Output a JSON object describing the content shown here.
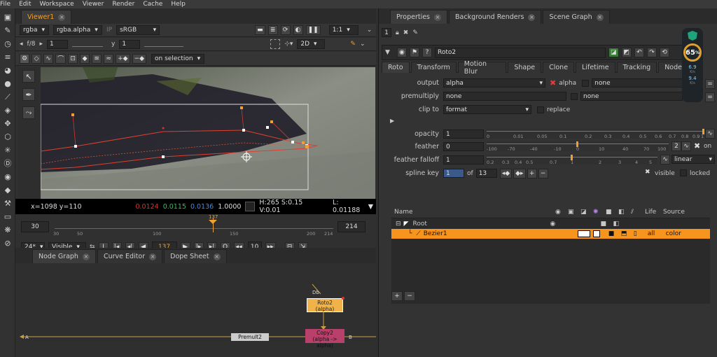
{
  "menu": [
    "File",
    "Edit",
    "Workspace",
    "Viewer",
    "Render",
    "Cache",
    "Help"
  ],
  "viewer": {
    "tab": "Viewer1",
    "channels": "rgba",
    "channel_alpha": "rgba.alpha",
    "ip": "IP",
    "colorspace": "sRGB",
    "zoom": "1:1",
    "fstop": "f/8",
    "frame_inc": "1",
    "y_label": "y",
    "y_value": "1",
    "mode2d": "2D",
    "onselection": "on selection",
    "info": {
      "coords": "x=1098 y=110",
      "r": "0.0124",
      "g": "0.0115",
      "b": "0.0136",
      "a": "1.0000",
      "hsv": "H:265 S:0.15 V:0.01",
      "lum": "L: 0.01188"
    },
    "timeline": {
      "start": "30",
      "end": "214",
      "current": "137",
      "ticks": [
        "30",
        "50",
        "100",
        "150",
        "200",
        "214"
      ],
      "fps": "24*",
      "visible": "Visible",
      "frame": "137",
      "step": "10"
    }
  },
  "nodegraph": {
    "tabs": [
      "Node Graph",
      "Curve Editor",
      "Dope Sheet"
    ],
    "nodes": {
      "roto": "Roto2",
      "roto_sub": "(alpha)",
      "copy": "Copy2",
      "copy_sub": "(alpha -> alpha)",
      "premult": "Premult2"
    },
    "pin_a": "A",
    "pin_b": "B",
    "pin_db": "Db"
  },
  "properties": {
    "tabs": [
      "Properties",
      "Background Renders",
      "Scene Graph"
    ],
    "count": "1",
    "node_name": "Roto2",
    "subtabs": [
      "Roto",
      "Transform",
      "Motion Blur",
      "Shape",
      "Clone",
      "Lifetime",
      "Tracking",
      "Node"
    ],
    "output_label": "output",
    "output_value": "alpha",
    "alpha_label": "alpha",
    "output_none": "none",
    "premultiply_label": "premultiply",
    "premultiply_value": "none",
    "premultiply_none": "none",
    "clipto_label": "clip to",
    "clipto_value": "format",
    "replace_label": "replace",
    "opacity_label": "opacity",
    "opacity_value": "1",
    "opacity_ticks": [
      "0",
      "0.01",
      "0.05",
      "0.1",
      "0.2",
      "0.3",
      "0.4",
      "0.5",
      "0.6",
      "0.7",
      "0.8",
      "0.9",
      "1"
    ],
    "feather_label": "feather",
    "feather_value": "0",
    "feather_ticks": [
      "-100",
      "-70",
      "-40",
      "-10",
      "0",
      "10",
      "40",
      "70",
      "100"
    ],
    "feather_count": "2",
    "feather_on": "on",
    "falloff_label": "feather falloff",
    "falloff_value": "1",
    "falloff_ticks": [
      "0.2",
      "0.3",
      "0.4",
      "0.5",
      "0.7",
      "1",
      "2",
      "3",
      "4",
      "5"
    ],
    "falloff_type": "linear",
    "splinekey_label": "spline key",
    "splinekey_value": "1",
    "splinekey_of": "of",
    "splinekey_total": "13",
    "visible_label": "visible",
    "locked_label": "locked",
    "table": {
      "headers": [
        "Name",
        "Life",
        "Source"
      ],
      "rows": [
        {
          "name": "Root",
          "life": "",
          "source": ""
        },
        {
          "name": "Bezier1",
          "life": "all",
          "source": "color"
        }
      ]
    }
  },
  "hud": {
    "percent": "65",
    "unit": "%",
    "up": "6.9",
    "down": "9.4",
    "rate_unit": "K/s"
  },
  "colors": {
    "accent": "#f0a030",
    "selection": "#f7941d",
    "red": "#e03030",
    "green": "#30c060",
    "blue": "#4a8ae0"
  }
}
